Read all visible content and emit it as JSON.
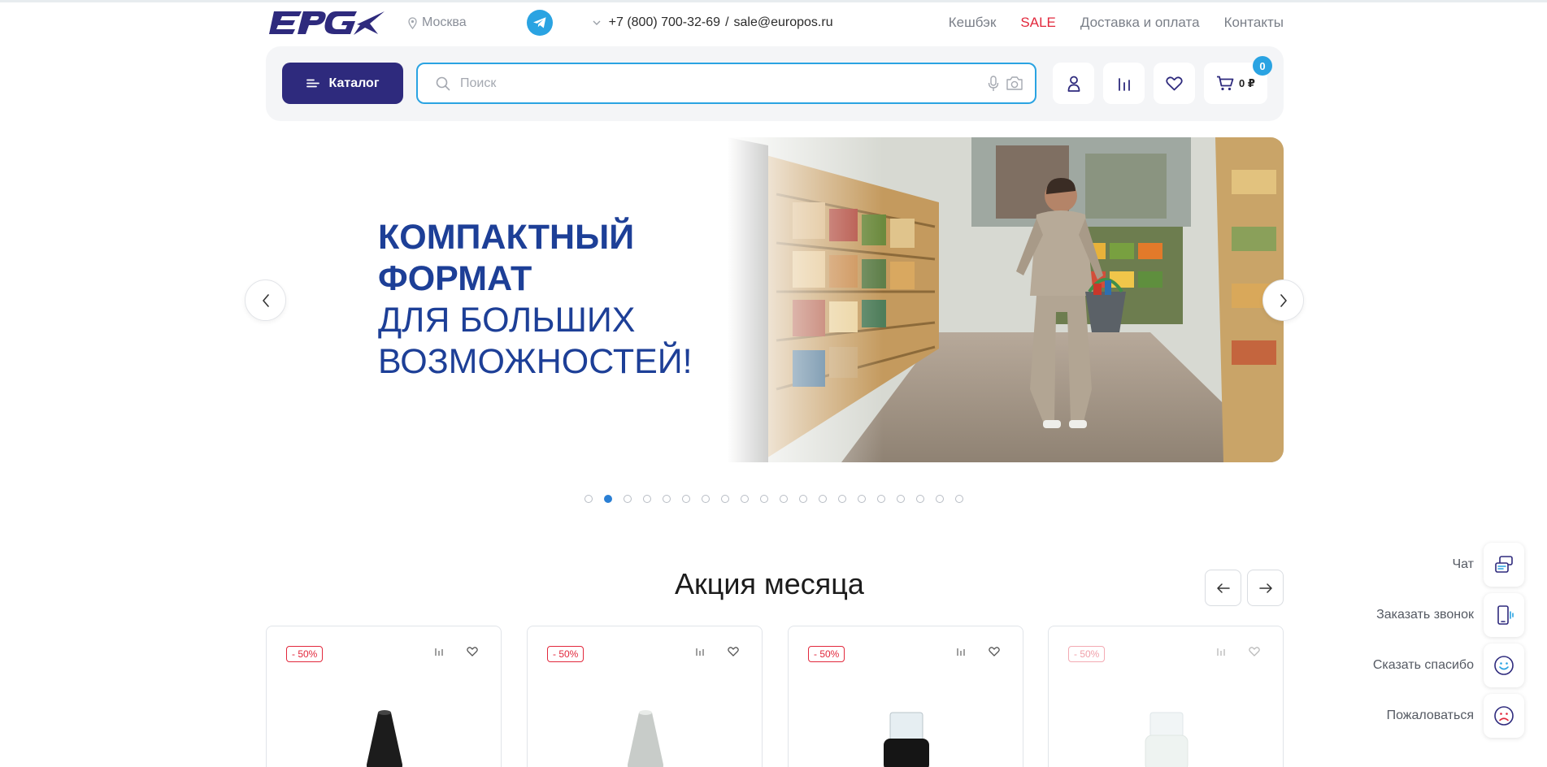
{
  "header": {
    "city": "Москва",
    "phone": "+7 (800) 700-32-69",
    "separator": "/",
    "email": "sale@europos.ru",
    "links": [
      "Кешбэк",
      "SALE",
      "Доставка и оплата",
      "Контакты"
    ]
  },
  "toolbar": {
    "catalog_label": "Каталог",
    "search_placeholder": "Поиск",
    "search_value": "",
    "cart_total": "0 ₽",
    "cart_count": "0"
  },
  "banner": {
    "line1": "КОМПАКТНЫЙ",
    "line2": "ФОРМАТ",
    "line3": "ДЛЯ БОЛЬШИХ",
    "line4": "ВОЗМОЖНОСТЕЙ!",
    "slide_count": 20,
    "active_slide": 2
  },
  "promo": {
    "title": "Акция месяца",
    "products": [
      {
        "discount": "- 50%"
      },
      {
        "discount": "- 50%"
      },
      {
        "discount": "- 50%"
      },
      {
        "discount": "- 50%"
      }
    ]
  },
  "widgets": {
    "chat": "Чат",
    "callback": "Заказать звонок",
    "thanks": "Сказать спасибо",
    "complain": "Пожаловаться"
  },
  "colors": {
    "brand": "#2e2a7d",
    "accent": "#2aa3e2",
    "sale": "#e2283c",
    "banner_text": "#1d3f97"
  }
}
